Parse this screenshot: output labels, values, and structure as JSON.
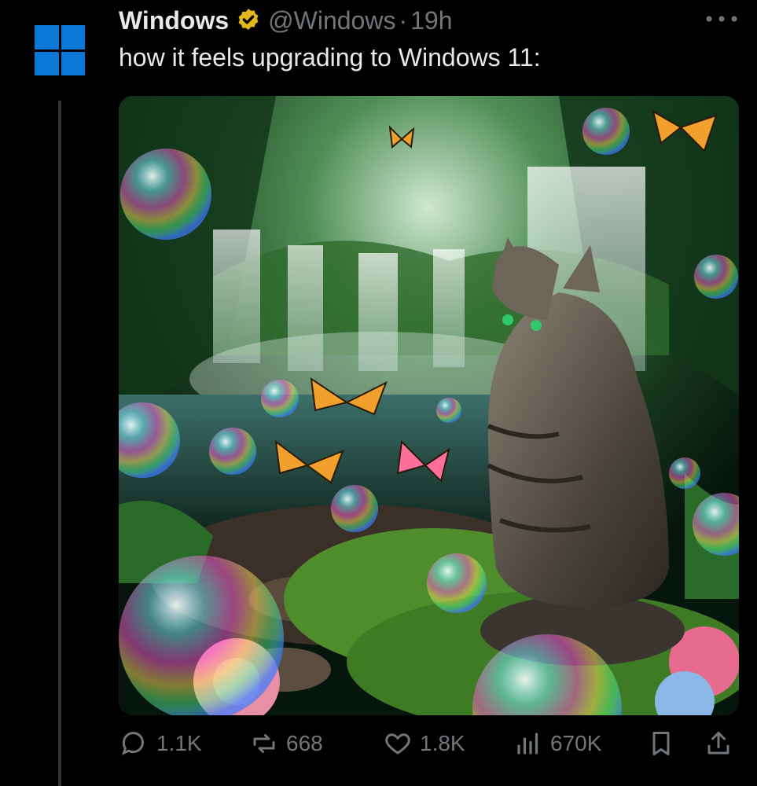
{
  "post": {
    "author_name": "Windows",
    "handle": "@Windows",
    "separator": "·",
    "time": "19h",
    "text": "how it feels upgrading to Windows 11:"
  },
  "media": {
    "icons": [
      "cat",
      "bubbles",
      "butterflies",
      "waterfall",
      "flowers"
    ]
  },
  "actions": {
    "replies": "1.1K",
    "reposts": "668",
    "likes": "1.8K",
    "views": "670K"
  },
  "icons": {
    "more": "more-horizontal-icon",
    "reply": "reply-icon",
    "repost": "repost-icon",
    "like": "heart-icon",
    "views": "views-icon",
    "bookmark": "bookmark-icon",
    "share": "share-icon"
  },
  "colors": {
    "background": "#000000",
    "text": "#e7e9ea",
    "muted": "#71767b",
    "windows_blue": "#0a78d4",
    "verified_gold": "#e2b719"
  }
}
